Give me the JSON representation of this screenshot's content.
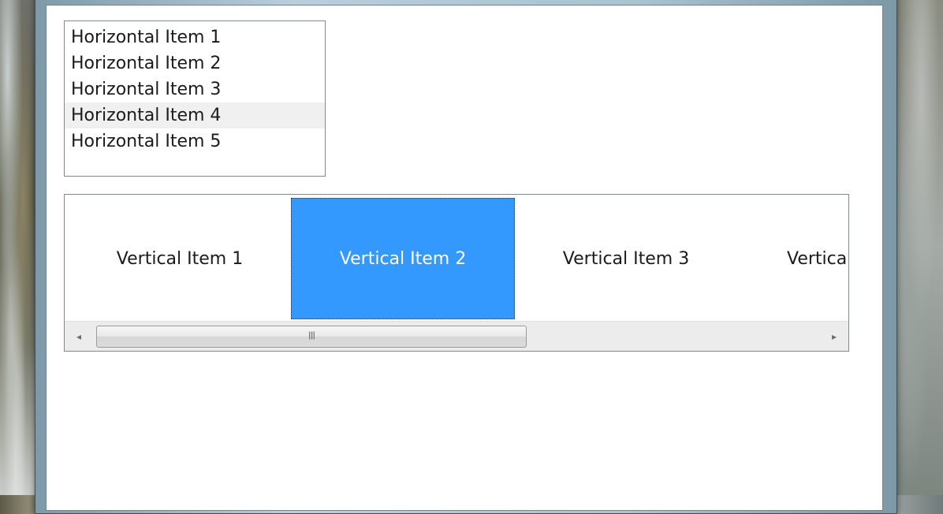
{
  "horizontal_list": {
    "items": [
      {
        "label": "Horizontal Item 1"
      },
      {
        "label": "Horizontal Item 2"
      },
      {
        "label": "Horizontal Item 3"
      },
      {
        "label": "Horizontal Item 4"
      },
      {
        "label": "Horizontal Item 5"
      }
    ],
    "hovered_index": 3
  },
  "vertical_panel": {
    "items": [
      {
        "label": "Vertical Item 1"
      },
      {
        "label": "Vertical Item 2"
      },
      {
        "label": "Vertical Item 3"
      },
      {
        "label": "Vertica"
      }
    ],
    "selected_index": 1,
    "selected_color": "#3399ff"
  },
  "scrollbar": {
    "left_arrow": "◂",
    "right_arrow": "▸",
    "grip": "III"
  }
}
